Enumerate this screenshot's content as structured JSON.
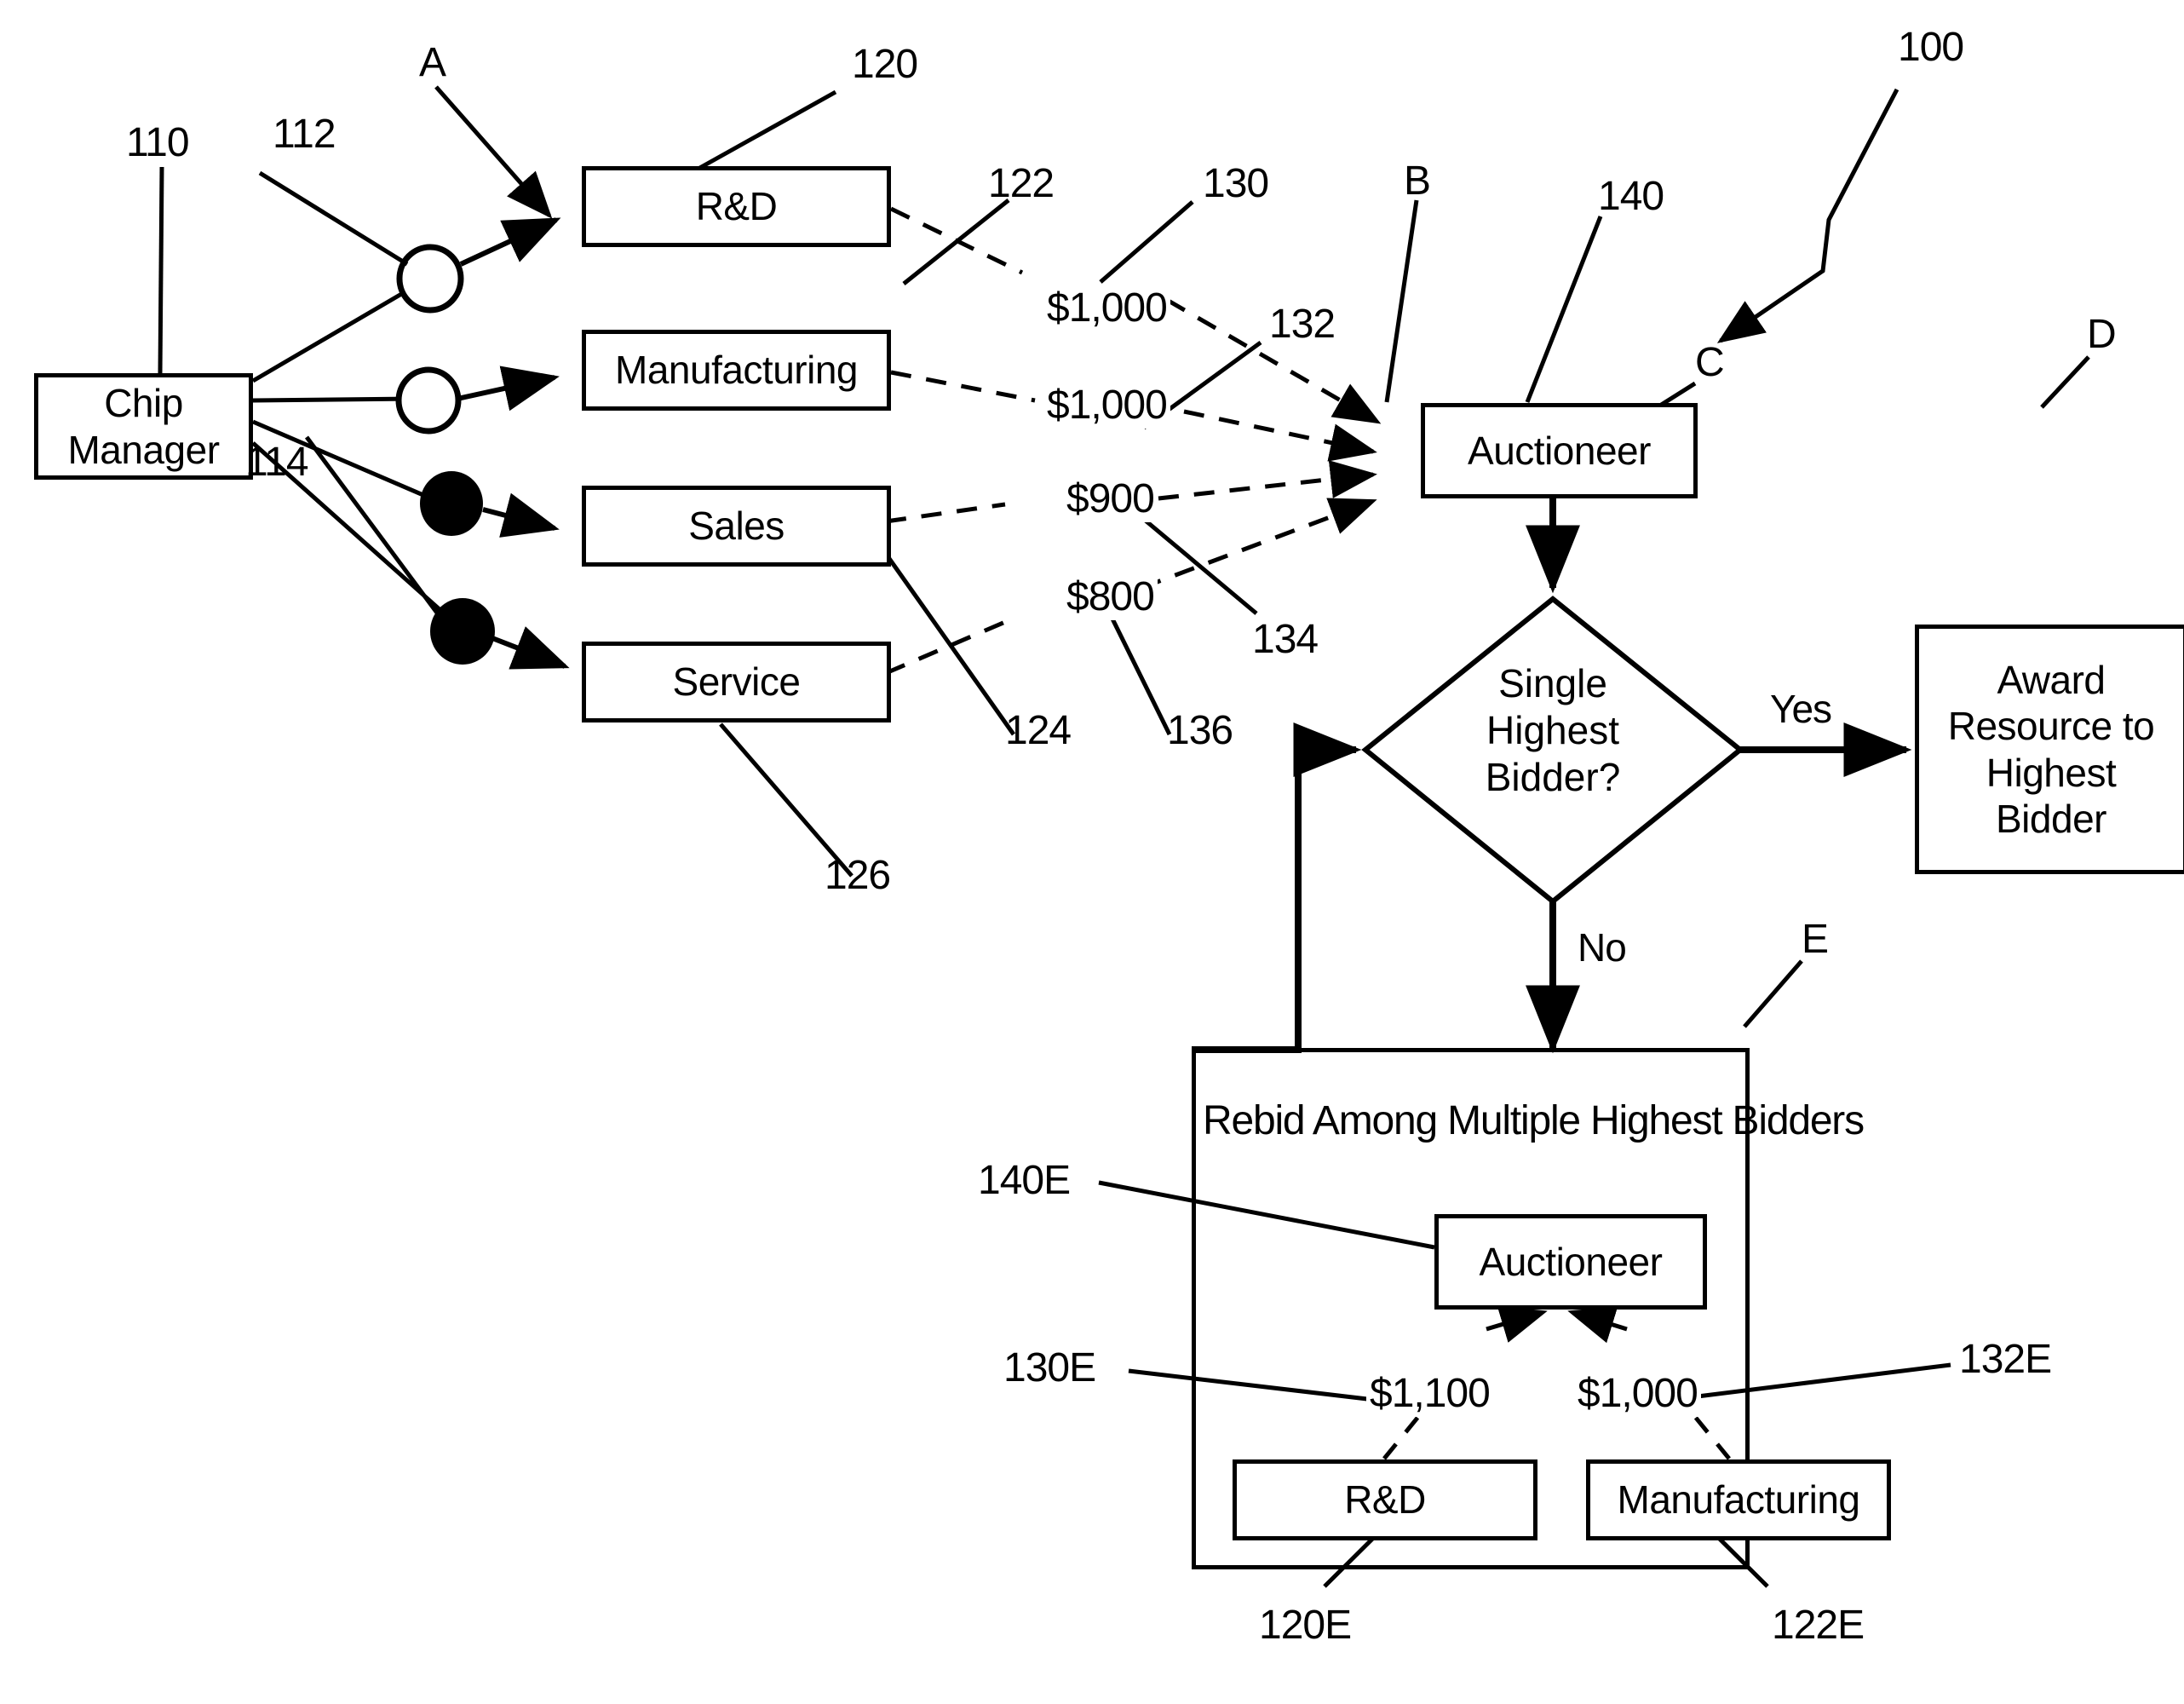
{
  "figure": {
    "ref_overall": "100"
  },
  "nodes": {
    "chip_manager": {
      "label": "Chip\nManager",
      "ref": "110"
    },
    "rnd": {
      "label": "R&D",
      "ref": "120"
    },
    "manufacturing": {
      "label": "Manufacturing",
      "ref": "122"
    },
    "sales": {
      "label": "Sales",
      "ref": "124"
    },
    "service": {
      "label": "Service",
      "ref": "126"
    },
    "auctioneer": {
      "label": "Auctioneer",
      "ref": "140",
      "pointer": "B"
    },
    "decision": {
      "label": "Single\nHighest\nBidder?",
      "pointer": "C"
    },
    "award": {
      "label": "Award\nResource to\nHighest\nBidder",
      "pointer": "D"
    },
    "rebid": {
      "title": "Rebid Among Multiple Highest Bidders",
      "pointer": "E"
    },
    "rebid_auctioneer": {
      "label": "Auctioneer",
      "ref": "140E"
    },
    "rebid_rnd": {
      "label": "R&D",
      "ref": "120E"
    },
    "rebid_manufacturing": {
      "label": "Manufacturing",
      "ref": "122E"
    }
  },
  "ports": {
    "open_circle_ref": "112",
    "filled_circle_ref": "114",
    "pointer_a": "A"
  },
  "bids": [
    {
      "amount": "$1,000",
      "ref": "130",
      "from": "R&D"
    },
    {
      "amount": "$1,000",
      "ref": "132",
      "from": "Manufacturing"
    },
    {
      "amount": "$900",
      "ref": "134",
      "from": "Sales"
    },
    {
      "amount": "$800",
      "ref": "136",
      "from": "Service"
    }
  ],
  "rebids": [
    {
      "amount": "$1,100",
      "ref": "130E",
      "from": "R&D"
    },
    {
      "amount": "$1,000",
      "ref": "132E",
      "from": "Manufacturing"
    }
  ],
  "edges": {
    "yes": "Yes",
    "no": "No"
  }
}
